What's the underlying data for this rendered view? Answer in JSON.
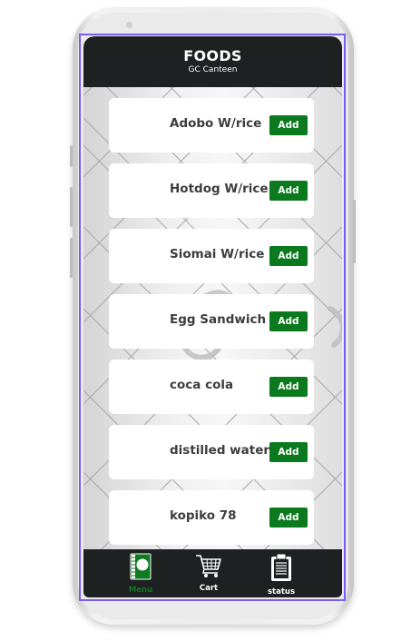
{
  "header": {
    "title": "FOODS",
    "subtitle": "GC Canteen"
  },
  "items": [
    {
      "name": "Adobo W/rice",
      "button": "Add"
    },
    {
      "name": "Hotdog W/rice",
      "button": "Add"
    },
    {
      "name": "Siomai W/rice",
      "button": "Add"
    },
    {
      "name": "Egg Sandwich",
      "button": "Add"
    },
    {
      "name": "coca cola",
      "button": "Add"
    },
    {
      "name": "distilled water",
      "button": "Add"
    },
    {
      "name": "kopiko 78",
      "button": "Add"
    }
  ],
  "nav": {
    "menu": {
      "label": "Menu",
      "icon": "menu-book-icon"
    },
    "cart": {
      "label": "Cart",
      "icon": "cart-icon"
    },
    "status": {
      "label": "status",
      "icon": "clipboard-icon"
    }
  },
  "colors": {
    "header_bg": "#1d2122",
    "add_button": "#0b7a1e",
    "active_nav": "#0e7a22",
    "frame_outline": "#7b5cf0"
  }
}
